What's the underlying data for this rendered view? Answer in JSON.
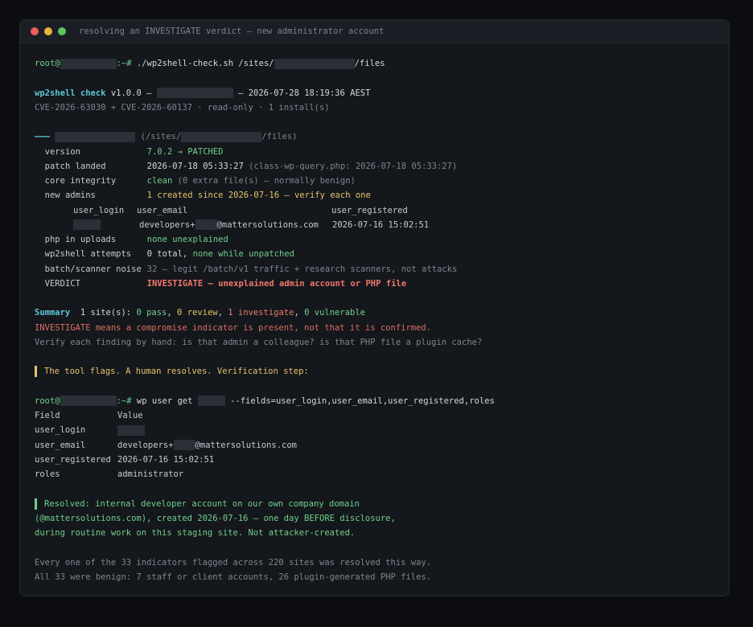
{
  "window": {
    "title": "resolving an INVESTIGATE verdict — new administrator account"
  },
  "cmd1": {
    "prompt_user": "root@",
    "prompt_tail": ":~# ",
    "command_a": "./wp2shell-check.sh /sites/",
    "command_b": "/files"
  },
  "header": {
    "tool": "wp2shell check",
    "version": " v1.0.0 — ",
    "timestamp": " — 2026-07-28 18:19:36 AEST",
    "cves": "CVE-2026-63030 + CVE-2026-60137 · read-only · 1 install(s)"
  },
  "site": {
    "dash": "———",
    "path_a": "(/sites/",
    "path_b": "/files)"
  },
  "rows": {
    "version": {
      "label": "version",
      "value": "7.0.2 → PATCHED"
    },
    "patch": {
      "label": "patch landed",
      "value": "2026-07-18 05:33:27",
      "note": " (class-wp-query.php: 2026-07-18 05:33:27)"
    },
    "core": {
      "label": "core integrity",
      "value": "clean",
      "note": " (0 extra file(s) — normally benign)"
    },
    "admins": {
      "label": "new admins",
      "value": "1 created since 2026-07-16 — verify each one"
    },
    "admin_cols": {
      "login": "user_login",
      "email": "user_email",
      "registered": "user_registered"
    },
    "admin_row": {
      "email_a": "developers+",
      "email_b": "@mattersolutions.com",
      "registered": "2026-07-16 15:02:51"
    },
    "php": {
      "label": "php in uploads",
      "value": "none unexplained"
    },
    "attempts": {
      "label": "wp2shell attempts",
      "value_a": "0 total, ",
      "value_b": "none while unpatched"
    },
    "noise": {
      "label": "batch/scanner noise",
      "value": "32 — legit /batch/v1 traffic + research scanners, not attacks"
    },
    "verdict": {
      "label": "VERDICT",
      "value": "INVESTIGATE — unexplained admin account or PHP file"
    }
  },
  "summary": {
    "label": "Summary",
    "sites": "  1 site(s): ",
    "pass": "0 pass",
    "review": "0 review",
    "investigate": "1 investigate",
    "vulnerable": "0 vulnerable",
    "sep": ", ",
    "note1": "INVESTIGATE means a compromise indicator is present, not that it is confirmed.",
    "note2": "Verify each finding by hand: is that admin a colleague? is that PHP file a plugin cache?"
  },
  "callout1": "The tool flags. A human resolves. Verification step:",
  "cmd2": {
    "command_a": "wp user get ",
    "command_b": " --fields=user_login,user_email,user_registered,roles"
  },
  "table": {
    "h_field": "Field",
    "h_value": "Value",
    "login": "user_login",
    "email": "user_email",
    "email_a": "developers+",
    "email_b": "@mattersolutions.com",
    "registered": "user_registered",
    "registered_val": "2026-07-16 15:02:51",
    "roles": "roles",
    "roles_val": "administrator"
  },
  "resolved": {
    "l1": "Resolved: internal developer account on our own company domain",
    "l2": "(@mattersolutions.com), created 2026-07-16 — one day BEFORE disclosure,",
    "l3": "during routine work on this staging site. Not attacker-created."
  },
  "footer": {
    "l1": "Every one of the 33 indicators flagged across 220 sites was resolved this way.",
    "l2": "All 33 were benign: 7 staff or client accounts, 26 plugin-generated PHP files."
  },
  "colors": {
    "green": "#72d08a",
    "yellow": "#e5c467",
    "red": "#ee7a6e",
    "cyan": "#5ec4d6"
  }
}
